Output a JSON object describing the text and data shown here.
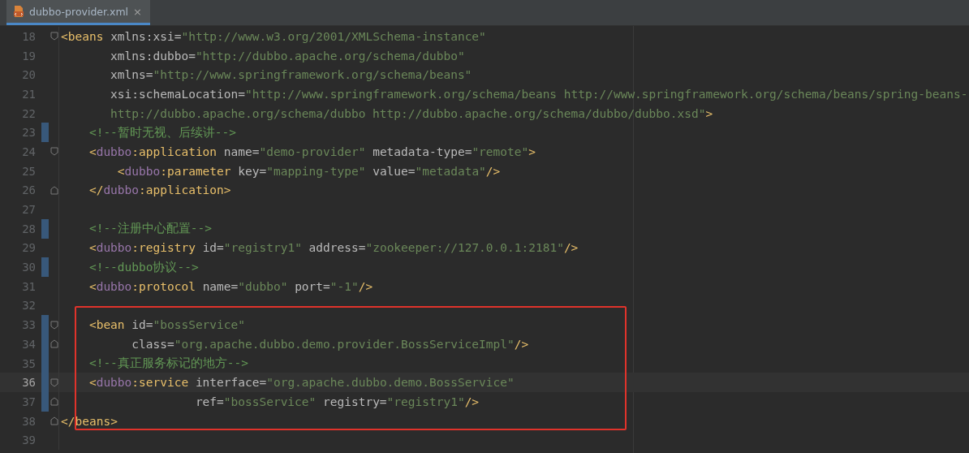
{
  "tabs": [
    {
      "label": "dubbo-provider.xml",
      "selected": true,
      "close": "×"
    }
  ],
  "lines": [
    {
      "number": "18",
      "fold_start": true,
      "fold_end": false,
      "modified": false,
      "current": false,
      "code": "<beans xmlns:xsi=\"http://www.w3.org/2001/XMLSchema-instance\""
    },
    {
      "number": "19",
      "fold_start": false,
      "fold_end": false,
      "modified": false,
      "current": false,
      "code": "       xmlns:dubbo=\"http://dubbo.apache.org/schema/dubbo\""
    },
    {
      "number": "20",
      "fold_start": false,
      "fold_end": false,
      "modified": false,
      "current": false,
      "code": "       xmlns=\"http://www.springframework.org/schema/beans\""
    },
    {
      "number": "21",
      "fold_start": false,
      "fold_end": false,
      "modified": false,
      "current": false,
      "code": "       xsi:schemaLocation=\"http://www.springframework.org/schema/beans http://www.springframework.org/schema/beans/spring-beans-"
    },
    {
      "number": "22",
      "fold_start": false,
      "fold_end": false,
      "modified": false,
      "current": false,
      "code": "       http://dubbo.apache.org/schema/dubbo http://dubbo.apache.org/schema/dubbo/dubbo.xsd\">"
    },
    {
      "number": "23",
      "fold_start": false,
      "fold_end": false,
      "modified": true,
      "current": false,
      "code": "    <!--暂时无视、后续讲-->"
    },
    {
      "number": "24",
      "fold_start": true,
      "fold_end": false,
      "modified": false,
      "current": false,
      "code": "    <dubbo:application name=\"demo-provider\" metadata-type=\"remote\">"
    },
    {
      "number": "25",
      "fold_start": false,
      "fold_end": false,
      "modified": false,
      "current": false,
      "code": "        <dubbo:parameter key=\"mapping-type\" value=\"metadata\"/>"
    },
    {
      "number": "26",
      "fold_start": false,
      "fold_end": true,
      "modified": false,
      "current": false,
      "code": "    </dubbo:application>"
    },
    {
      "number": "27",
      "fold_start": false,
      "fold_end": false,
      "modified": false,
      "current": false
    },
    {
      "number": "28",
      "fold_start": false,
      "fold_end": false,
      "modified": true,
      "current": false,
      "code": "    <!--注册中心配置-->"
    },
    {
      "number": "29",
      "fold_start": false,
      "fold_end": false,
      "modified": false,
      "current": false,
      "code": "    <dubbo:registry id=\"registry1\" address=\"zookeeper://127.0.0.1:2181\"/>"
    },
    {
      "number": "30",
      "fold_start": false,
      "fold_end": false,
      "modified": true,
      "current": false,
      "code": "    <!--dubbo协议-->"
    },
    {
      "number": "31",
      "fold_start": false,
      "fold_end": false,
      "modified": false,
      "current": false,
      "code": "    <dubbo:protocol name=\"dubbo\" port=\"-1\"/>"
    },
    {
      "number": "32",
      "fold_start": false,
      "fold_end": false,
      "modified": false,
      "current": false
    }
  ],
  "highlighted_lines": [
    {
      "number": "33",
      "fold_start": true,
      "fold_end": false,
      "modified": true,
      "current": false,
      "code": "    <bean id=\"bossService\""
    },
    {
      "number": "34",
      "fold_start": false,
      "fold_end": true,
      "modified": true,
      "current": false,
      "code": "          class=\"org.apache.dubbo.demo.provider.BossServiceImpl\"/>"
    },
    {
      "number": "35",
      "fold_start": false,
      "fold_end": false,
      "modified": true,
      "current": false,
      "code": "    <!--真正服务标记的地方-->"
    },
    {
      "number": "36",
      "fold_start": true,
      "fold_end": false,
      "modified": true,
      "current": true,
      "code": "    <dubbo:service interface=\"org.apache.dubbo.demo.BossService\""
    },
    {
      "number": "37",
      "fold_start": false,
      "fold_end": true,
      "modified": true,
      "current": false,
      "code": "                   ref=\"bossService\" registry=\"registry1\"/>"
    },
    {
      "number": "38",
      "fold_start": false,
      "fold_end": true,
      "modified": false,
      "current": false,
      "code": "</beans>"
    }
  ],
  "lines_after": [
    {
      "number": "39",
      "fold_start": false,
      "fold_end": false,
      "modified": false,
      "current": false
    }
  ]
}
